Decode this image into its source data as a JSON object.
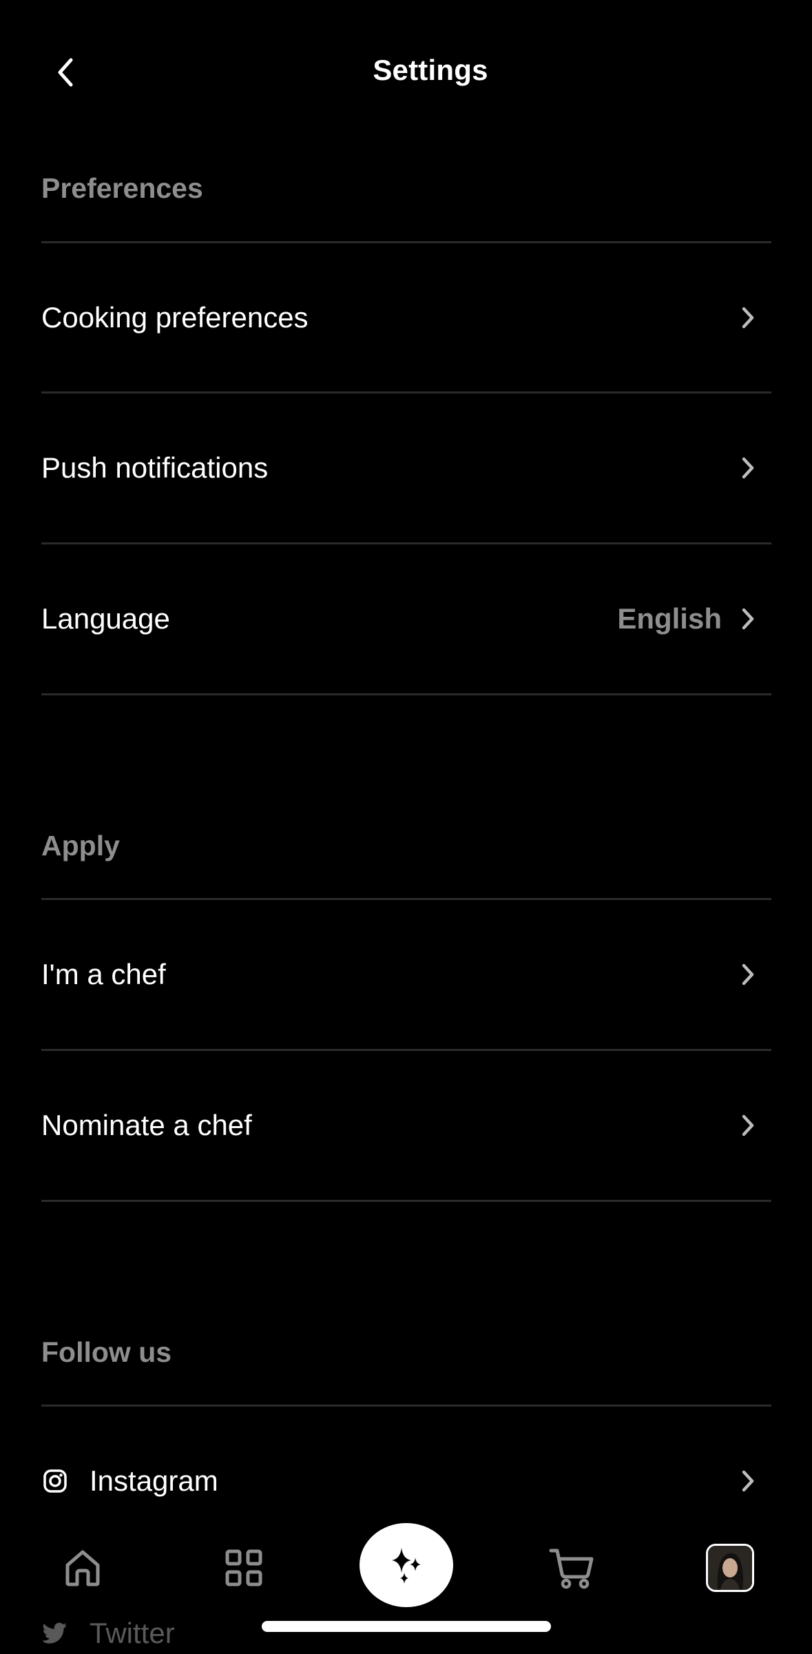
{
  "header": {
    "title": "Settings",
    "back_icon": "chevron-left-icon"
  },
  "sections": {
    "preferences": {
      "label": "Preferences",
      "items": {
        "cooking": {
          "label": "Cooking preferences"
        },
        "push": {
          "label": "Push notifications"
        },
        "language": {
          "label": "Language",
          "value": "English"
        }
      }
    },
    "apply": {
      "label": "Apply",
      "items": {
        "chef": {
          "label": "I'm a chef"
        },
        "nominate": {
          "label": "Nominate a chef"
        }
      }
    },
    "follow": {
      "label": "Follow us",
      "items": {
        "instagram": {
          "label": "Instagram",
          "icon": "instagram-icon"
        },
        "twitter": {
          "label": "Twitter",
          "icon": "twitter-icon"
        }
      }
    }
  },
  "tabbar": {
    "items": [
      "home-icon",
      "grid-icon",
      "sparkle-icon",
      "cart-icon",
      "avatar"
    ],
    "active": "sparkle-icon"
  },
  "colors": {
    "background": "#000000",
    "text": "#ffffff",
    "secondary_text": "#8e8e8e",
    "divider": "#2b2b2b"
  }
}
